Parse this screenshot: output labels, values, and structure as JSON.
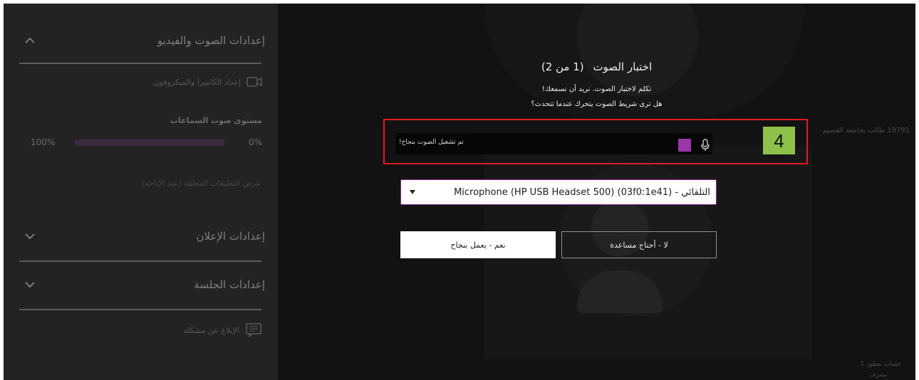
{
  "sidebar": {
    "sections": [
      {
        "title": "إعدادات الصوت والفيديو",
        "expanded": true
      },
      {
        "title": "إعدادات الإعلان",
        "expanded": false
      },
      {
        "title": "إعدادات الجلسة",
        "expanded": false
      }
    ],
    "camera_mic_setup": "إعداد الكاميرا والميكروفون",
    "speaker_volume_label": "مستوى صوت السماعات",
    "volume_max": "100%",
    "volume_min": "0%",
    "captions_note": "عرض التعليقات المغلقة (عند الإتاحة)",
    "report_problem": "الإبلاغ عن مشكلة"
  },
  "background": {
    "participant_count": "19791 طالب بجامعة القصيم",
    "user_name": "حساب مطور 1",
    "user_role": "مشرف"
  },
  "audio_test": {
    "title": "اختبار الصوت",
    "step": "(1 من 2)",
    "instruction_1": "تكلم لاختبار الصوت. نريد أن نسمعك!",
    "instruction_2": "هل ترى شريط الصوت يتحرك عندما تتحدث؟",
    "status_text": "تم تشغيل الصوت بنجاح!",
    "mic_select_value": "التلقائي - (Microphone (HP USB Headset 500) (03f0:1e41",
    "yes_button": "نعم - يعمل بنجاح",
    "no_button": "لا - أحتاج مساعدة",
    "level_color": "#9b36aa"
  },
  "annotation": {
    "step_number": "4",
    "highlight_color": "#e31b23",
    "badge_color": "#8dc14a"
  }
}
